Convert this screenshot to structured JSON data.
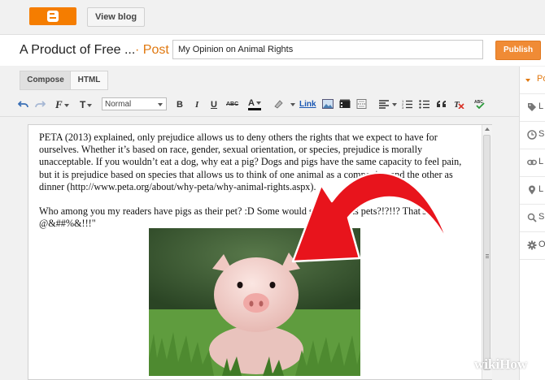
{
  "topbar": {
    "logo_icon": "blogger-logo-icon",
    "view_blog": "View blog"
  },
  "titlebar": {
    "blog_name": "A Product of Free ...",
    "separator": "· Post",
    "post_title": "My Opinion on Animal Rights",
    "publish": "Publish"
  },
  "mode_tabs": [
    {
      "label": "Compose"
    },
    {
      "label": "HTML"
    }
  ],
  "toolbar": {
    "undo_icon": "undo-icon",
    "redo_icon": "redo-icon",
    "font_family_label": "F",
    "font_size_label": "T",
    "format_select": "Normal",
    "bold": "B",
    "italic": "I",
    "underline": "U",
    "strike": "ABC",
    "text_color": "A",
    "link": "Link",
    "accent_color": "#d93025"
  },
  "editor": {
    "paragraphs": [
      "PETA (2013) explained, only prejudice allows us to deny others the rights that we expect to have for ourselves. Whether it’s based on race, gender, sexual orientation, or species, prejudice is morally unacceptable. If you wouldn’t eat a dog, why eat a pig? Dogs and pigs have the same capacity to feel pain, but it is prejudice based on species that allows us to think of one animal as a companion and the other as dinner (http://www.peta.org/about/why-peta/why-animal-rights.aspx).",
      "Who among you my readers have pigs as their pet? :D Some would say, \"Pigs as pets?!?!!? That's @&##%&!!!\""
    ],
    "image_subject": "piglet-photo",
    "annotation_arrow_color": "#e8141c"
  },
  "sidebar": {
    "items": [
      "Po",
      "L",
      "S",
      "L",
      "L",
      "S",
      "O"
    ]
  },
  "watermark": {
    "wiki": "wiki",
    "how": "How"
  }
}
